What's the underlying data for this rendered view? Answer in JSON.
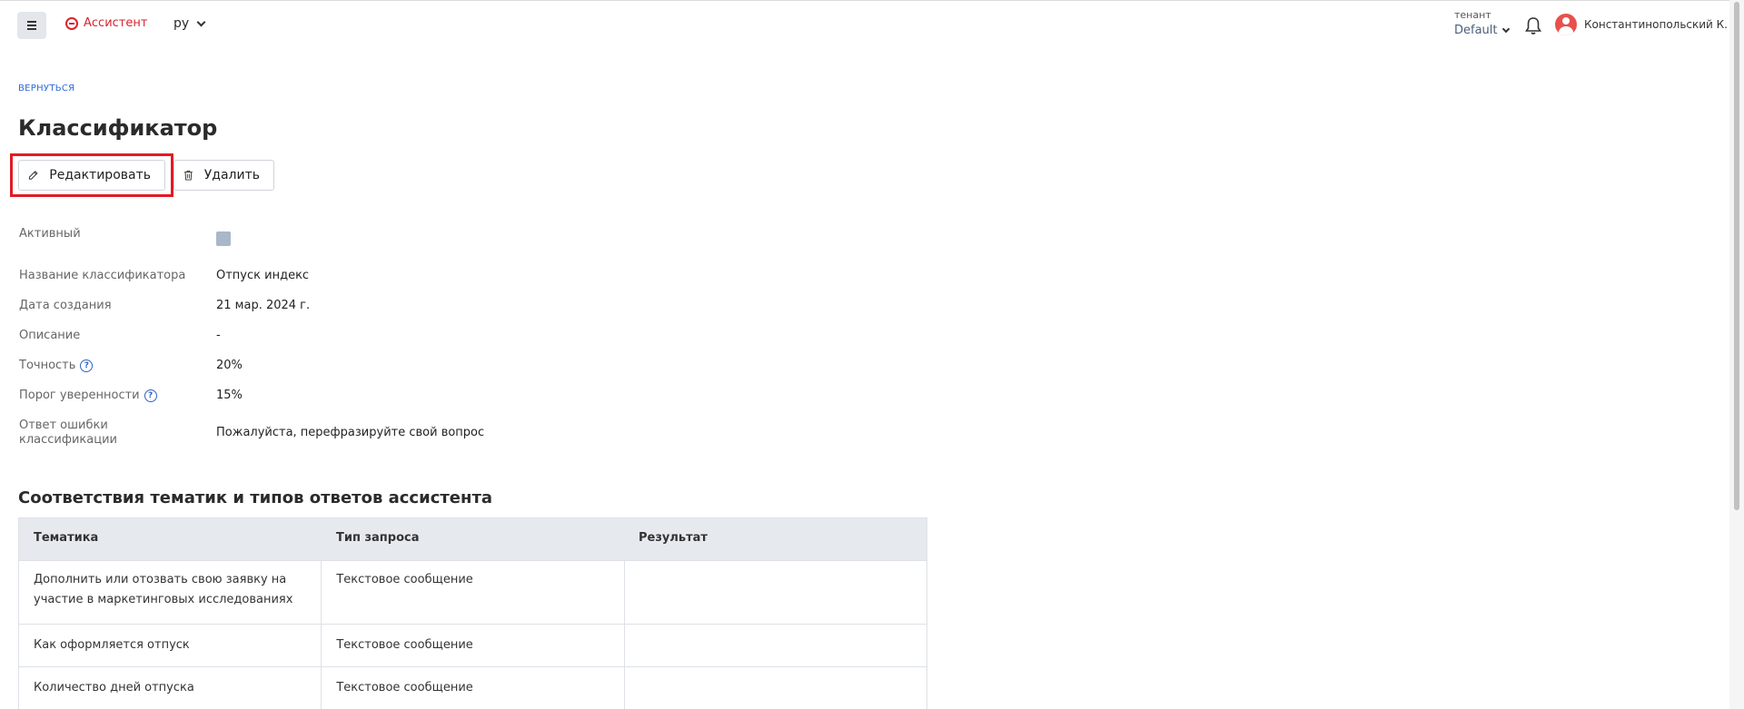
{
  "header": {
    "brand": "Ассистент",
    "language": "ру",
    "tenant_label": "тенант",
    "tenant_value": "Default",
    "username": "Константинопольский К."
  },
  "page": {
    "back_link": "ВЕРНУТЬСЯ",
    "title": "Классификатор",
    "edit_label": "Редактировать",
    "delete_label": "Удалить"
  },
  "properties": [
    {
      "label": "Активный",
      "value": ""
    },
    {
      "label": "Название классификатора",
      "value": "Отпуск индекс"
    },
    {
      "label": "Дата создания",
      "value": "21 мар. 2024 г."
    },
    {
      "label": "Описание",
      "value": "-"
    },
    {
      "label": "Точность",
      "value": "20%"
    },
    {
      "label": "Порог уверенности",
      "value": "15%"
    },
    {
      "label": "Ответ ошибки классификации",
      "value": "Пожалуйста, перефразируйте свой вопрос"
    }
  ],
  "mapping": {
    "title": "Соответствия тематик и типов ответов ассистента",
    "headers": [
      "Тематика",
      "Тип запроса",
      "Результат"
    ],
    "rows": [
      [
        "Дополнить или отозвать свою заявку на участие в маркетинговых исследованиях",
        "Текстовое сообщение",
        ""
      ],
      [
        "Как оформляется отпуск",
        "Текстовое сообщение",
        ""
      ],
      [
        "Количество дней отпуска",
        "Текстовое сообщение",
        ""
      ]
    ]
  },
  "colors": {
    "brand": "#d9232d",
    "link": "#2e6bd6",
    "highlight": "#e21b24",
    "table_header_bg": "#e6eaef"
  }
}
